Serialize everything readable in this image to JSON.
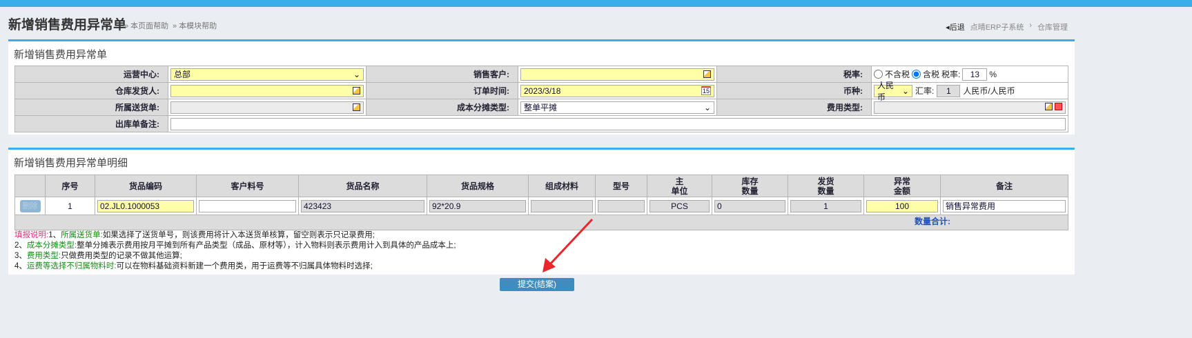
{
  "header": {
    "title": "新增销售费用异常单",
    "help_page": "» 本页面帮助",
    "help_module": "» 本模块帮助",
    "back": "◂后退",
    "crumb_system": "点晴ERP子系统",
    "crumb_sep": "›",
    "crumb_module": "仓库管理"
  },
  "form": {
    "title": "新增销售费用异常单",
    "ops_center_label": "运营中心:",
    "ops_center_value": "总部",
    "customer_label": "销售客户:",
    "customer_value": "",
    "tax_label": "税率:",
    "tax_excl": "不含税",
    "tax_incl": "含税",
    "tax_rate_label": "税率:",
    "tax_rate_value": "13",
    "percent": "%",
    "shipper_label": "仓库发货人:",
    "shipper_value": "",
    "order_time_label": "订单时间:",
    "order_time_value": "2023/3/18",
    "currency_label": "币种:",
    "currency_value": "人民币",
    "rate_label": "汇率:",
    "rate_value": "1",
    "rate_unit": "人民币/人民币",
    "delivery_label": "所属送货单:",
    "delivery_value": "",
    "cost_alloc_label": "成本分摊类型:",
    "cost_alloc_value": "整单平摊",
    "fee_type_label": "费用类型:",
    "fee_type_value": "",
    "remark_label": "出库单备注:",
    "remark_value": ""
  },
  "detail": {
    "title": "新增销售费用异常单明细",
    "columns": [
      "",
      "序号",
      "货品编码",
      "客户料号",
      "货品名称",
      "货品规格",
      "组成材料",
      "型号",
      "主\n单位",
      "库存\n数量",
      "发货\n数量",
      "异常\n金额",
      "备注"
    ],
    "rows": [
      {
        "delete": "删除",
        "seq": "1",
        "code": "02.JL0.1000053",
        "cust_no": "",
        "name": "423423",
        "spec": "92*20.9",
        "material": "",
        "model": "",
        "unit": "PCS",
        "stock": "0",
        "ship_qty": "1",
        "amount": "100",
        "remark": "销售异常费用"
      }
    ],
    "total_label": "数量合计:"
  },
  "notes": {
    "head": "填报说明:",
    "n1_pre": "1、",
    "n1_key": "所属送货单:",
    "n1_text": "如果选择了送货单号，则该费用将计入本送货单核算，留空则表示只记录费用;",
    "n2_pre": "2、",
    "n2_key": "成本分摊类型:",
    "n2_text": "整单分摊表示费用按月平摊到所有产品类型（成品、原材等），计入物料则表示费用计入到具体的产品成本上;",
    "n3_pre": "3、",
    "n3_key": "费用类型:",
    "n3_text": "只做费用类型的记录不做其他运算;",
    "n4_pre": "4、",
    "n4_key": "运费等选择不归属物料时:",
    "n4_text": "可以在物料基础资料新建一个费用类，用于运费等不归属具体物料时选择;"
  },
  "submit_label": "提交(结案)"
}
